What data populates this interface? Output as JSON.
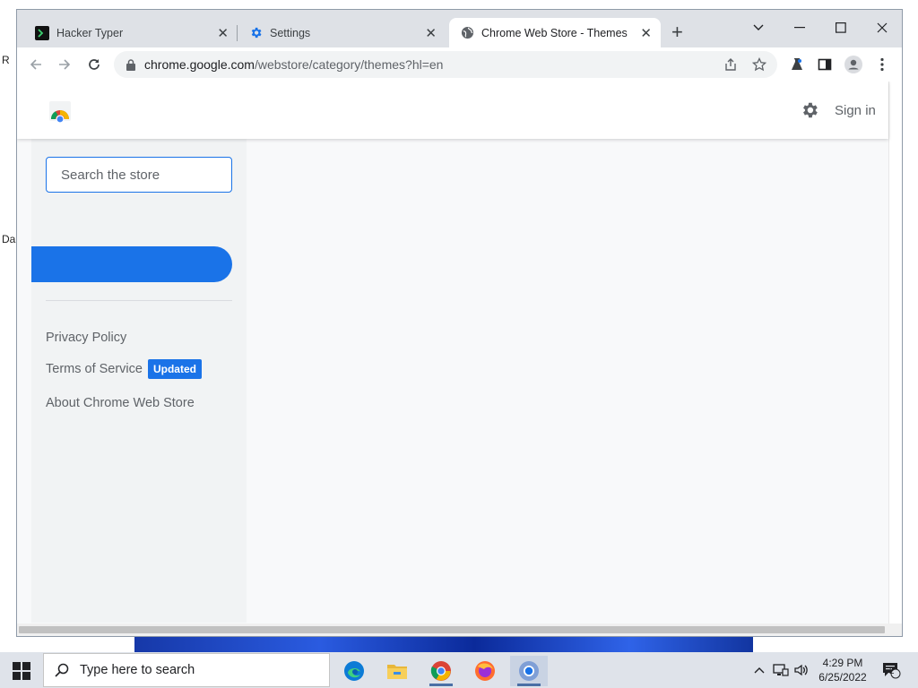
{
  "browser": {
    "tabs": [
      {
        "title": "Hacker Typer",
        "icon": "terminal-icon",
        "active": false
      },
      {
        "title": "Settings",
        "icon": "gear-icon",
        "active": false
      },
      {
        "title": "Chrome Web Store - Themes",
        "icon": "globe-icon",
        "active": true
      }
    ],
    "url_domain": "chrome.google.com",
    "url_path": "/webstore/category/themes?hl=en"
  },
  "page": {
    "sign_in_label": "Sign in",
    "search_placeholder": "Search the store",
    "footer_links": {
      "privacy": "Privacy Policy",
      "terms": "Terms of Service",
      "terms_badge": "Updated",
      "about": "About Chrome Web Store"
    }
  },
  "taskbar": {
    "search_placeholder": "Type here to search",
    "time": "4:29 PM",
    "date": "6/25/2022",
    "notification_count": "2"
  },
  "colors": {
    "accent": "#1a73e8",
    "tab_strip": "#dee1e6",
    "page_bg": "#f8f9fa"
  }
}
